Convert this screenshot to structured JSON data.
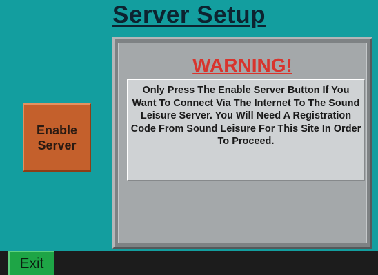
{
  "screen": {
    "title": "Server Setup"
  },
  "buttons": {
    "enable_server": "Enable\nServer",
    "exit": "Exit"
  },
  "warning_panel": {
    "heading": "WARNING!",
    "message": "Only Press The Enable Server Button If You Want To Connect Via The Internet To The Sound Leisure Server. You Will Need A Registration Code From Sound Leisure For This Site In Order To Proceed."
  },
  "colors": {
    "background": "#139e9f",
    "enable_button": "#c4602c",
    "warning_heading": "#d8342d",
    "exit_button": "#1ea546",
    "bottom_bar": "#1c1c1c"
  }
}
